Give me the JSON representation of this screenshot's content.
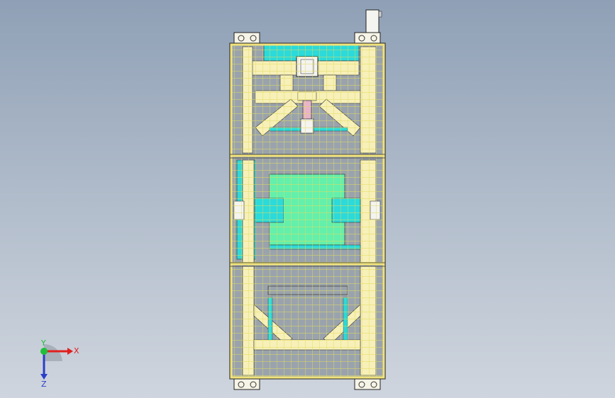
{
  "view": {
    "background_top": "#8fa0b6",
    "background_bottom": "#cfd5de",
    "frame_color": "#f4e89a",
    "grid_color": "#e8e06a",
    "panel_fill_cyan": "#26d6d6",
    "panel_fill_green": "#5ff0a8",
    "cylinder_color": "#e8b4c8"
  },
  "triad": {
    "x_label": "X",
    "y_label": "Y",
    "z_label": "Z",
    "x_color": "#e0201e",
    "y_color": "#1fbf3a",
    "z_color": "#2a3fc8"
  }
}
